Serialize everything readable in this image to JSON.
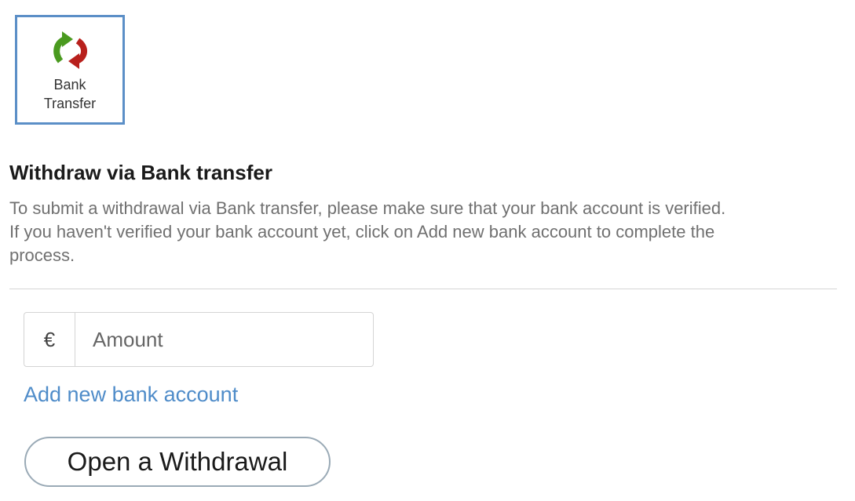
{
  "payment_method": {
    "label_line1": "Bank",
    "label_line2": "Transfer",
    "icon": "bank-transfer-arrows-icon",
    "arrow_colors": {
      "green": "#4a9a1f",
      "red": "#b8201c"
    },
    "selected_border_color": "#5b8fc7"
  },
  "section": {
    "title": "Withdraw via Bank transfer",
    "description_line1": "To submit a withdrawal via Bank transfer, please make sure that your bank account is verified.",
    "description_line2": "If you haven't verified your bank account yet, click on Add new bank account to complete the",
    "description_line3": "process."
  },
  "amount_field": {
    "currency_symbol": "€",
    "placeholder": "Amount",
    "value": ""
  },
  "links": {
    "add_bank_account": "Add new bank account",
    "link_color": "#4f8cc9"
  },
  "buttons": {
    "open_withdrawal": "Open a Withdrawal"
  }
}
